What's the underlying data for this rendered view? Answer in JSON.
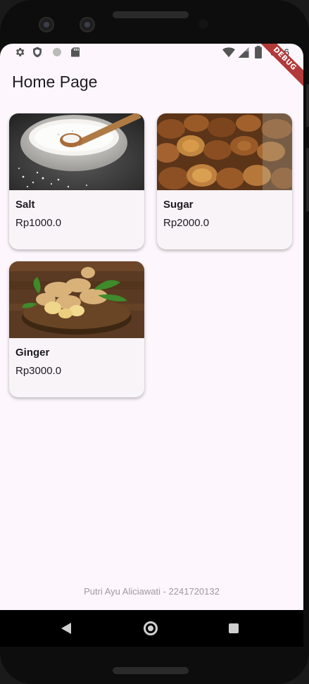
{
  "status_bar": {
    "time": "6:06",
    "debug_label": "DEBUG",
    "icons_left": [
      "settings-icon",
      "shield-icon",
      "circle-icon",
      "sd-card-icon"
    ],
    "icons_right": [
      "wifi-icon",
      "signal-icon",
      "battery-icon"
    ]
  },
  "app_bar": {
    "title": "Home Page"
  },
  "products": [
    {
      "name": "Salt",
      "price": "Rp1000.0",
      "image": "salt-bowl-image"
    },
    {
      "name": "Sugar",
      "price": "Rp2000.0",
      "image": "palm-sugar-image"
    },
    {
      "name": "Ginger",
      "price": "Rp3000.0",
      "image": "ginger-image"
    }
  ],
  "footer": {
    "text": "Putri Ayu Aliciawati - 2241720132"
  },
  "nav_bar": {
    "buttons": [
      "back-icon",
      "home-icon",
      "recents-icon"
    ]
  },
  "colors": {
    "background": "#fdf6fc",
    "card": "#f8f4f8",
    "debug_ribbon": "#b23a3a"
  }
}
